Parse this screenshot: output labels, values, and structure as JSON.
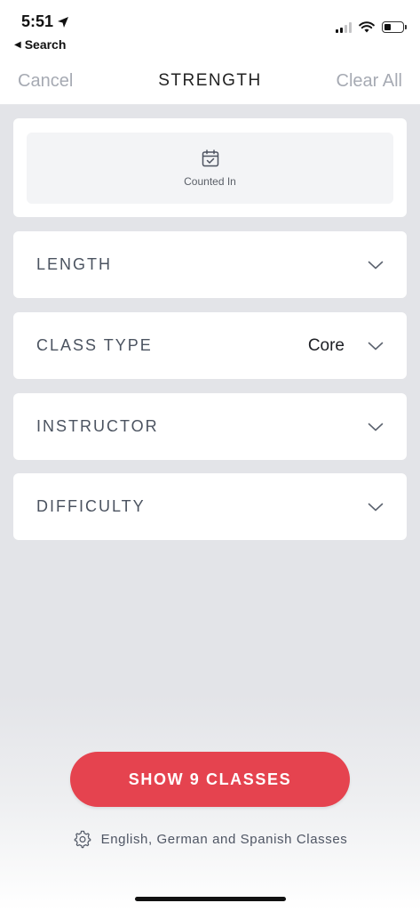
{
  "status_bar": {
    "time": "5:51",
    "back_app": "Search"
  },
  "nav": {
    "cancel": "Cancel",
    "title": "STRENGTH",
    "clear_all": "Clear All"
  },
  "counted_in": {
    "label": "Counted In",
    "icon": "calendar-check-icon"
  },
  "filters": [
    {
      "label": "LENGTH",
      "value": ""
    },
    {
      "label": "CLASS TYPE",
      "value": "Core"
    },
    {
      "label": "INSTRUCTOR",
      "value": ""
    },
    {
      "label": "DIFFICULTY",
      "value": ""
    }
  ],
  "footer": {
    "show_button": "SHOW 9 CLASSES",
    "language_note": "English, German and Spanish Classes"
  },
  "colors": {
    "accent": "#e5434f",
    "background": "#e3e4e8",
    "label": "#4b5360",
    "muted": "#a6aab3"
  }
}
